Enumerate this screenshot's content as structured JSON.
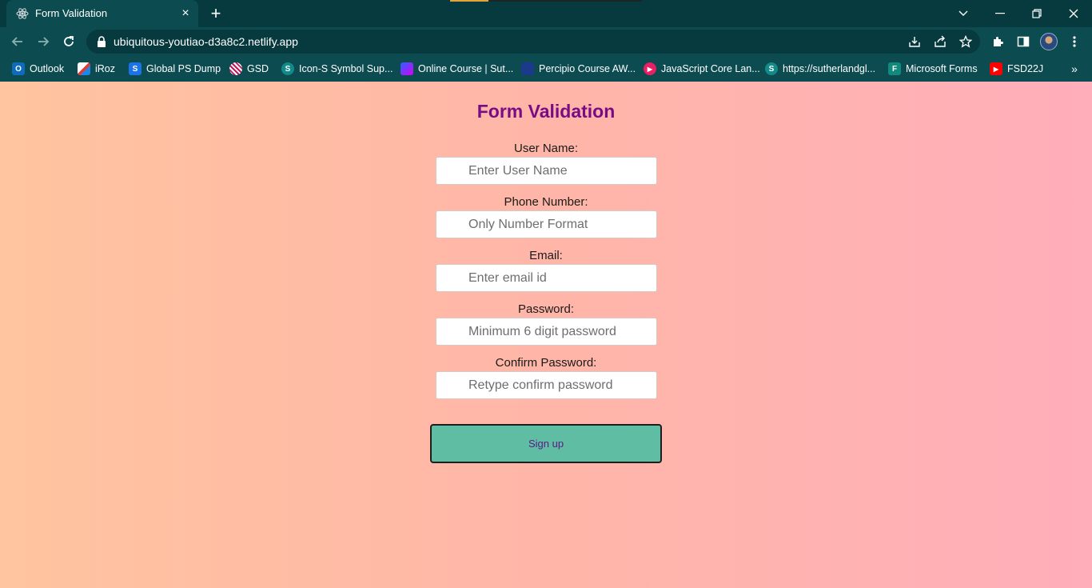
{
  "browser": {
    "tab": {
      "title": "Form Validation",
      "favicon": "react-icon",
      "close": "×"
    },
    "new_tab": "+",
    "url": "ubiquitous-youtiao-d3a8c2.netlify.app",
    "bookmarks": [
      {
        "label": "Outlook",
        "icon": "outlook-icon",
        "color": "#0f6cbd",
        "glyph": "O"
      },
      {
        "label": "iRoz",
        "icon": "iroz-icon",
        "color": "#ffffff",
        "glyph": ""
      },
      {
        "label": "Global PS Dump",
        "icon": "sharepoint-icon",
        "color": "#1a73e8",
        "glyph": "S"
      },
      {
        "label": "GSD",
        "icon": "gsd-icon",
        "color": "#c2185b",
        "glyph": ""
      },
      {
        "label": "Icon-S Symbol Sup...",
        "icon": "sharepoint-icon",
        "color": "#128a8a",
        "glyph": "S"
      },
      {
        "label": "Online Course | Sut...",
        "icon": "course-icon",
        "color": "#7b2fbe",
        "glyph": ""
      },
      {
        "label": "Percipio Course AW...",
        "icon": "percipio-icon",
        "color": "#1b3b8a",
        "glyph": ""
      },
      {
        "label": "JavaScript Core Lan...",
        "icon": "play-icon",
        "color": "#e91e63",
        "glyph": "▶"
      },
      {
        "label": "https://sutherlandgl...",
        "icon": "sharepoint-icon",
        "color": "#128a8a",
        "glyph": "S"
      },
      {
        "label": "Microsoft Forms",
        "icon": "forms-icon",
        "color": "#0f8a7d",
        "glyph": "F"
      },
      {
        "label": "FSD22J",
        "icon": "youtube-icon",
        "color": "#ff0000",
        "glyph": "▶"
      }
    ],
    "bookmarks_more": "»"
  },
  "form": {
    "title": "Form Validation",
    "fields": [
      {
        "label": "User Name:",
        "placeholder": "Enter User Name"
      },
      {
        "label": "Phone Number:",
        "placeholder": "Only Number Format"
      },
      {
        "label": "Email:",
        "placeholder": "Enter email id"
      },
      {
        "label": "Password:",
        "placeholder": "Minimum 6 digit password"
      },
      {
        "label": "Confirm Password:",
        "placeholder": "Retype confirm password"
      }
    ],
    "submit_label": "Sign up"
  }
}
